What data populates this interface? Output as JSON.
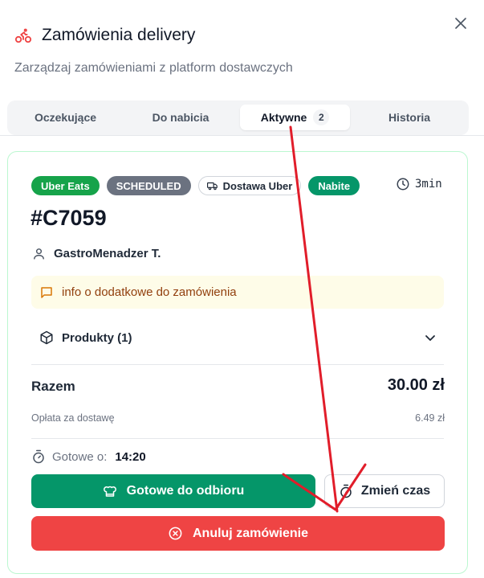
{
  "dialog": {
    "title": "Zamówienia delivery",
    "subtitle": "Zarządzaj zamówieniami z platform dostawczych",
    "icons": {
      "title": "bike-icon",
      "close": "close-icon"
    }
  },
  "tabs": [
    {
      "label": "Oczekujące"
    },
    {
      "label": "Do nabicia"
    },
    {
      "label": "Aktywne",
      "badge": "2",
      "active": true
    },
    {
      "label": "Historia"
    }
  ],
  "order": {
    "badges": {
      "platform": "Uber Eats",
      "schedule": "SCHEDULED",
      "delivery": "Dostawa Uber",
      "status": "Nabite"
    },
    "timer": "3min",
    "id": "#C7059",
    "customer": "GastroMenadzer T.",
    "note": "info o dodatkowe do zamówienia",
    "products_label": "Produkty (1)",
    "total_label": "Razem",
    "total_value": "30.00 zł",
    "fee_label": "Opłata za dostawę",
    "fee_value": "6.49 zł",
    "ready_label": "Gotowe o:",
    "ready_time": "14:20"
  },
  "actions": {
    "ready": "Gotowe do odbioru",
    "change_time": "Zmień czas",
    "cancel": "Anuluj zamówienie"
  },
  "colors": {
    "uber_green": "#16a34a",
    "scheduled_gray": "#6b7280",
    "status_green": "#059669",
    "cancel_red": "#ef4444",
    "annotation_red": "#e11d2a"
  }
}
